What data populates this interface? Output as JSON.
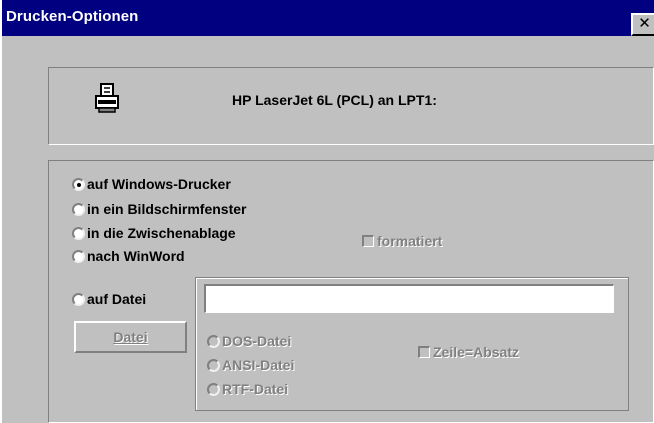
{
  "window": {
    "title": "Drucken-Optionen",
    "close_symbol": "✕"
  },
  "printer": {
    "icon": "printer-icon",
    "label": "HP LaserJet 6L (PCL) an LPT1:"
  },
  "output_options": [
    {
      "label": "auf Windows-Drucker",
      "checked": true
    },
    {
      "label": "in ein Bildschirmfenster",
      "checked": false
    },
    {
      "label": "in die Zwischenablage",
      "checked": false
    },
    {
      "label": "nach WinWord",
      "checked": false
    }
  ],
  "formatiert": {
    "label": "formatiert",
    "checked": false,
    "enabled": false
  },
  "file_option": {
    "label": "auf Datei",
    "checked": false
  },
  "file_path": {
    "value": "",
    "placeholder": ""
  },
  "datei_button": {
    "label": "Datei",
    "enabled": false
  },
  "file_types": [
    {
      "label": "DOS-Datei",
      "enabled": false
    },
    {
      "label": "ANSI-Datei",
      "enabled": false
    },
    {
      "label": "RTF-Datei",
      "enabled": false
    }
  ],
  "zeile_absatz": {
    "label": "Zeile=Absatz",
    "checked": false,
    "enabled": false
  }
}
